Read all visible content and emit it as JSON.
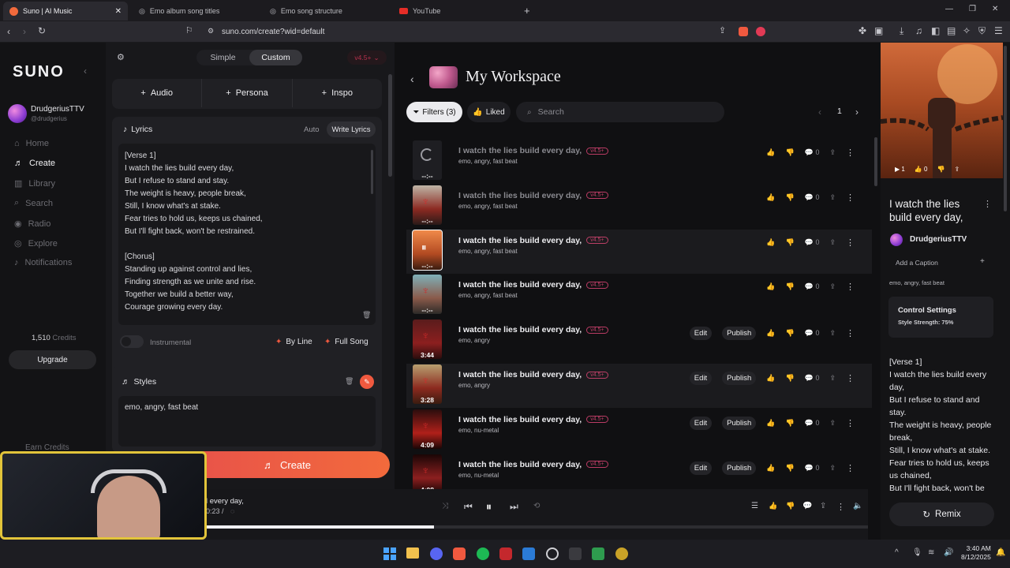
{
  "browser": {
    "tabs": [
      {
        "label": "Suno | AI Music",
        "fav": "#f26a3c"
      },
      {
        "label": "Emo album song titles",
        "fav": "#9a9aa0"
      },
      {
        "label": "Emo song structure",
        "fav": "#9a9aa0"
      },
      {
        "label": "YouTube",
        "fav": "#e52d27"
      }
    ],
    "url": "suno.com/create?wid=default"
  },
  "sidebar": {
    "logo": "SUNO",
    "user_name": "DrudgeriusTTV",
    "user_handle": "@drudgerius",
    "nav": [
      "Home",
      "Create",
      "Library",
      "Search",
      "Radio",
      "Explore",
      "Notifications"
    ],
    "credits_num": "1,510",
    "credits_label": "Credits",
    "upgrade": "Upgrade",
    "earn": "Earn Credits"
  },
  "create": {
    "mode_simple": "Simple",
    "mode_custom": "Custom",
    "version": "v4.5+",
    "add_audio": "Audio",
    "add_persona": "Persona",
    "add_inspo": "Inspo",
    "lyrics_label": "Lyrics",
    "auto": "Auto",
    "write_lyrics": "Write Lyrics",
    "lyrics": "[Verse 1]\nI watch the lies build every day,\nBut I refuse to stand and stay.\nThe weight is heavy, people break,\nStill, I know what's at stake.\nFear tries to hold us, keeps us chained,\nBut I'll fight back, won't be restrained.\n\n[Chorus]\nStanding up against control and lies,\nFinding strength as we unite and rise.\nTogether we build a better way,\nCourage growing every day.",
    "instrumental": "Instrumental",
    "by_line": "By Line",
    "full_song": "Full Song",
    "styles_label": "Styles",
    "styles_value": "emo, angry, fast beat",
    "create_btn": "Create"
  },
  "workspace": {
    "title": "My Workspace",
    "filters": "Filters (3)",
    "liked": "Liked",
    "search_placeholder": "Search",
    "page": "1",
    "rows": [
      {
        "title": "I watch the lies build every day,",
        "badge": "v4.5+",
        "tags": "emo, angry, fast beat",
        "duration": "--:--",
        "edit": "",
        "publish": "",
        "count": "0",
        "state": "loading"
      },
      {
        "title": "I watch the lies build every day,",
        "badge": "v4.5+",
        "tags": "emo, angry, fast beat",
        "duration": "--:--",
        "edit": "",
        "publish": "",
        "count": "0",
        "state": "pending"
      },
      {
        "title": "I watch the lies build every day,",
        "badge": "v4.5+",
        "tags": "emo, angry, fast beat",
        "duration": "--:--",
        "edit": "",
        "publish": "",
        "count": "0",
        "state": "playing"
      },
      {
        "title": "I watch the lies build every day,",
        "badge": "v4.5+",
        "tags": "emo, angry, fast beat",
        "duration": "--:--",
        "edit": "",
        "publish": "",
        "count": "0",
        "state": "ready"
      },
      {
        "title": "I watch the lies build every day,",
        "badge": "v4.5+",
        "tags": "emo, angry",
        "duration": "3:44",
        "edit": "Edit",
        "publish": "Publish",
        "count": "0",
        "state": "ready"
      },
      {
        "title": "I watch the lies build every day,",
        "badge": "v4.5+",
        "tags": "emo, angry",
        "duration": "3:28",
        "edit": "Edit",
        "publish": "Publish",
        "count": "0",
        "state": "ready"
      },
      {
        "title": "I watch the lies build every day,",
        "badge": "v4.5+",
        "tags": "emo, nu-metal",
        "duration": "4:09",
        "edit": "Edit",
        "publish": "Publish",
        "count": "0",
        "state": "ready"
      },
      {
        "title": "I watch the lies build every day,",
        "badge": "v4.5+",
        "tags": "emo, nu-metal",
        "duration": "4:08",
        "edit": "Edit",
        "publish": "Publish",
        "count": "0",
        "state": "ready"
      }
    ]
  },
  "right": {
    "likes": "1",
    "dislikes": "0",
    "title": "I watch the lies build every day,",
    "artist": "DrudgeriusTTV",
    "add_caption": "Add a Caption",
    "tags": "emo, angry, fast beat",
    "control_title": "Control Settings",
    "control_style": "Style Strength: 75%",
    "lyrics": "[Verse 1]\nI watch the lies build every\nday,\nBut I refuse to stand and\nstay.\nThe weight is heavy, people\nbreak,\nStill, I know what's at stake.\nFear tries to hold us, keeps\nus chained,\nBut I'll fight back, won't be",
    "remix": "Remix"
  },
  "player": {
    "title": "build every day,",
    "time": "00:23 /",
    "progress": 0.5
  },
  "taskbar": {
    "time": "3:40 AM",
    "date": "8/12/2025"
  },
  "colors": {
    "accent": "#f0593f",
    "badge": "#e7487a"
  }
}
